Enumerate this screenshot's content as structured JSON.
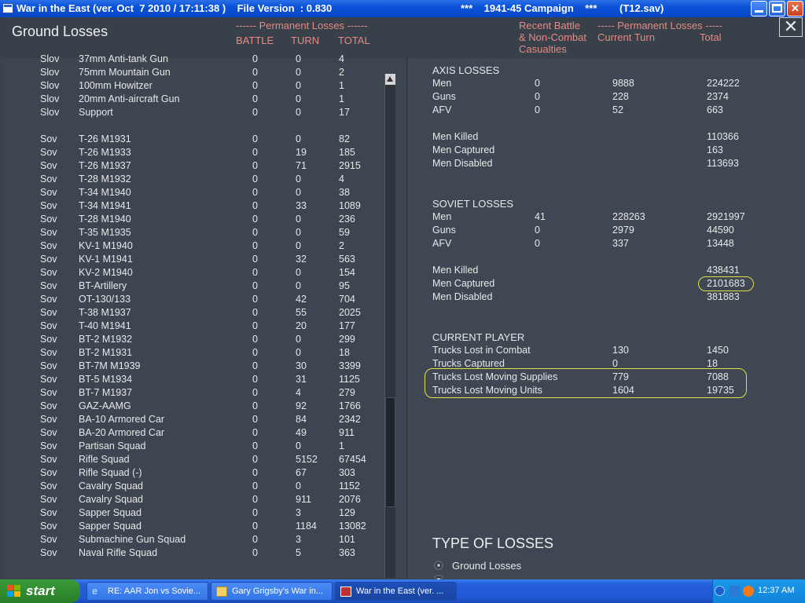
{
  "titlebar": {
    "title": "War in the East (ver. Oct  7 2010 / 17:11:38 )    File Version  : 0.830",
    "campaign": "***    1941-45 Campaign    ***",
    "save": "(T12.sav)"
  },
  "header": {
    "title": "Ground Losses",
    "perm_left": "------ Permanent Losses ------",
    "col_battle": "BATTLE",
    "col_turn": "TURN",
    "col_total": "TOTAL",
    "recent1": "Recent Battle",
    "recent2": "& Non-Combat",
    "recent3": "Casualties",
    "perm_right": "----- Permanent Losses -----",
    "current_turn": "Current Turn",
    "total": "Total"
  },
  "units": [
    [
      "Slov",
      "37mm Anti-tank Gun",
      "0",
      "0",
      "4"
    ],
    [
      "Slov",
      "75mm Mountain Gun",
      "0",
      "0",
      "2"
    ],
    [
      "Slov",
      "100mm Howitzer",
      "0",
      "0",
      "1"
    ],
    [
      "Slov",
      "20mm Anti-aircraft Gun",
      "0",
      "0",
      "1"
    ],
    [
      "Slov",
      "Support",
      "0",
      "0",
      "17"
    ],
    null,
    [
      "Sov",
      "T-26 M1931",
      "0",
      "0",
      "82"
    ],
    [
      "Sov",
      "T-26 M1933",
      "0",
      "19",
      "185"
    ],
    [
      "Sov",
      "T-26 M1937",
      "0",
      "71",
      "2915"
    ],
    [
      "Sov",
      "T-28 M1932",
      "0",
      "0",
      "4"
    ],
    [
      "Sov",
      "T-34 M1940",
      "0",
      "0",
      "38"
    ],
    [
      "Sov",
      "T-34 M1941",
      "0",
      "33",
      "1089"
    ],
    [
      "Sov",
      "T-28 M1940",
      "0",
      "0",
      "236"
    ],
    [
      "Sov",
      "T-35 M1935",
      "0",
      "0",
      "59"
    ],
    [
      "Sov",
      "KV-1 M1940",
      "0",
      "0",
      "2"
    ],
    [
      "Sov",
      "KV-1 M1941",
      "0",
      "32",
      "563"
    ],
    [
      "Sov",
      "KV-2 M1940",
      "0",
      "0",
      "154"
    ],
    [
      "Sov",
      "BT-Artillery",
      "0",
      "0",
      "95"
    ],
    [
      "Sov",
      "OT-130/133",
      "0",
      "42",
      "704"
    ],
    [
      "Sov",
      "T-38 M1937",
      "0",
      "55",
      "2025"
    ],
    [
      "Sov",
      "T-40 M1941",
      "0",
      "20",
      "177"
    ],
    [
      "Sov",
      "BT-2 M1932",
      "0",
      "0",
      "299"
    ],
    [
      "Sov",
      "BT-2 M1931",
      "0",
      "0",
      "18"
    ],
    [
      "Sov",
      "BT-7M M1939",
      "0",
      "30",
      "3399"
    ],
    [
      "Sov",
      "BT-5 M1934",
      "0",
      "31",
      "1125"
    ],
    [
      "Sov",
      "BT-7 M1937",
      "0",
      "4",
      "279"
    ],
    [
      "Sov",
      "GAZ-AAMG",
      "0",
      "92",
      "1766"
    ],
    [
      "Sov",
      "BA-10 Armored Car",
      "0",
      "84",
      "2342"
    ],
    [
      "Sov",
      "BA-20 Armored Car",
      "0",
      "49",
      "911"
    ],
    [
      "Sov",
      "Partisan Squad",
      "0",
      "0",
      "1"
    ],
    [
      "Sov",
      "Rifle Squad",
      "0",
      "5152",
      "67454"
    ],
    [
      "Sov",
      "Rifle Squad (-)",
      "0",
      "67",
      "303"
    ],
    [
      "Sov",
      "Cavalry Squad",
      "0",
      "0",
      "1152"
    ],
    [
      "Sov",
      "Cavalry Squad",
      "0",
      "911",
      "2076"
    ],
    [
      "Sov",
      "Sapper Squad",
      "0",
      "3",
      "129"
    ],
    [
      "Sov",
      "Sapper Squad",
      "0",
      "1184",
      "13082"
    ],
    [
      "Sov",
      "Submachine Gun Squad",
      "0",
      "3",
      "101"
    ],
    [
      "Sov",
      "Naval Rifle Squad",
      "0",
      "5",
      "363"
    ]
  ],
  "axis": {
    "title": "AXIS LOSSES",
    "men": [
      "Men",
      "0",
      "9888",
      "224222"
    ],
    "guns": [
      "Guns",
      "0",
      "228",
      "2374"
    ],
    "afv": [
      "AFV",
      "0",
      "52",
      "663"
    ],
    "killed": [
      "Men Killed",
      "110366"
    ],
    "captured": [
      "Men Captured",
      "163"
    ],
    "disabled": [
      "Men Disabled",
      "113693"
    ]
  },
  "soviet": {
    "title": "SOVIET LOSSES",
    "men": [
      "Men",
      "41",
      "228263",
      "2921997"
    ],
    "guns": [
      "Guns",
      "0",
      "2979",
      "44590"
    ],
    "afv": [
      "AFV",
      "0",
      "337",
      "13448"
    ],
    "killed": [
      "Men Killed",
      "438431"
    ],
    "captured": [
      "Men Captured",
      "2101683"
    ],
    "disabled": [
      "Men Disabled",
      "381883"
    ]
  },
  "player": {
    "title": "CURRENT PLAYER",
    "combat": [
      "Trucks Lost in Combat",
      "130",
      "1450"
    ],
    "captured": [
      "Trucks Captured",
      "0",
      "18"
    ],
    "supplies": [
      "Trucks Lost Moving Supplies",
      "779",
      "7088"
    ],
    "units": [
      "Trucks Lost Moving Units",
      "1604",
      "19735"
    ]
  },
  "types": {
    "title": "TYPE OF LOSSES",
    "ground": "Ground Losses"
  },
  "taskbar": {
    "start": "start",
    "task1": "RE: AAR Jon vs Sovie...",
    "task2": "Gary Grigsby's War in...",
    "task3": "War in the East (ver. ...",
    "clock": "12:37 AM"
  },
  "colors": {
    "highlight": "#e0e04a",
    "header_pink": "#e58a84"
  }
}
